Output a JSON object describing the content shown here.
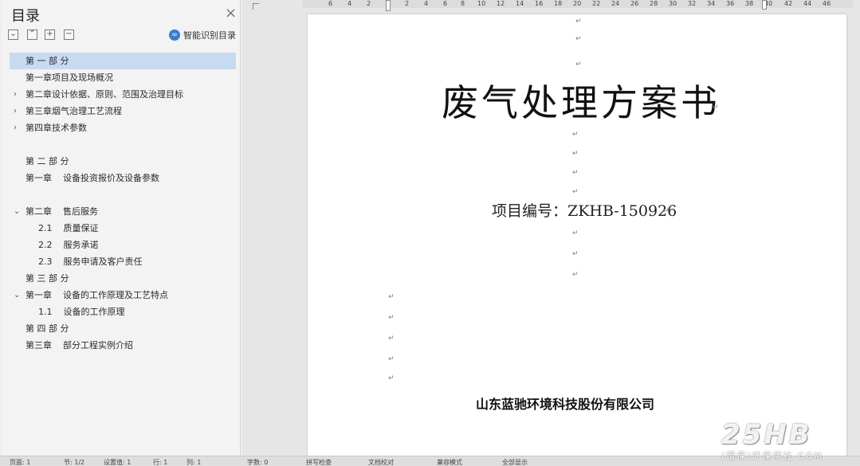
{
  "toc": {
    "title": "目录",
    "close_icon": "×",
    "tools": [
      "⌄",
      "⌃",
      "+",
      "−"
    ],
    "smart_icon": "∞",
    "smart_label": "智能识别目录",
    "items": [
      {
        "text": "第 一 部 分",
        "arrow": "",
        "selected": true
      },
      {
        "text": "第一章项目及现场概况",
        "arrow": ""
      },
      {
        "text": "第二章设计依据、原则、范围及治理目标",
        "arrow": "›"
      },
      {
        "text": "第三章烟气治理工艺流程",
        "arrow": "›"
      },
      {
        "text": "第四章技术参数",
        "arrow": "›"
      },
      {
        "text": "第 二 部 分",
        "arrow": ""
      },
      {
        "text": "第一章    设备投资报价及设备参数",
        "arrow": ""
      },
      {
        "text": "第二章    售后服务",
        "arrow": "⌄"
      },
      {
        "text": "2.1    质量保证",
        "arrow": ""
      },
      {
        "text": "2.2    服务承诺",
        "arrow": ""
      },
      {
        "text": "2.3    服务申请及客户责任",
        "arrow": ""
      },
      {
        "text": "第 三 部 分",
        "arrow": ""
      },
      {
        "text": "第一章    设备的工作原理及工艺特点",
        "arrow": "⌄"
      },
      {
        "text": "1.1    设备的工作原理",
        "arrow": ""
      },
      {
        "text": "第 四 部 分",
        "arrow": ""
      },
      {
        "text": "第三章    部分工程实例介绍",
        "arrow": ""
      }
    ]
  },
  "ruler": {
    "labels": [
      "6",
      "4",
      "2",
      "2",
      "4",
      "6",
      "8",
      "10",
      "12",
      "14",
      "16",
      "18",
      "20",
      "22",
      "24",
      "26",
      "28",
      "30",
      "32",
      "34",
      "36",
      "38",
      "40",
      "42",
      "44",
      "46"
    ]
  },
  "document": {
    "title": "废气处理方案书",
    "project_number": "项目编号：ZKHB-150926",
    "company": "山东蓝驰环境科技股份有限公司",
    "paragraph_mark": "↵"
  },
  "statusbar": {
    "items": [
      "页面: 1",
      "节: 1/2",
      "设置值: 1",
      "行: 1",
      "列: 1",
      "字数: 0",
      "拼写检查",
      "文档校对",
      "兼容模式",
      "全部显示"
    ]
  },
  "watermark": {
    "logo_text": "25HB",
    "sub_text": "(環保)环保学社·COM"
  }
}
